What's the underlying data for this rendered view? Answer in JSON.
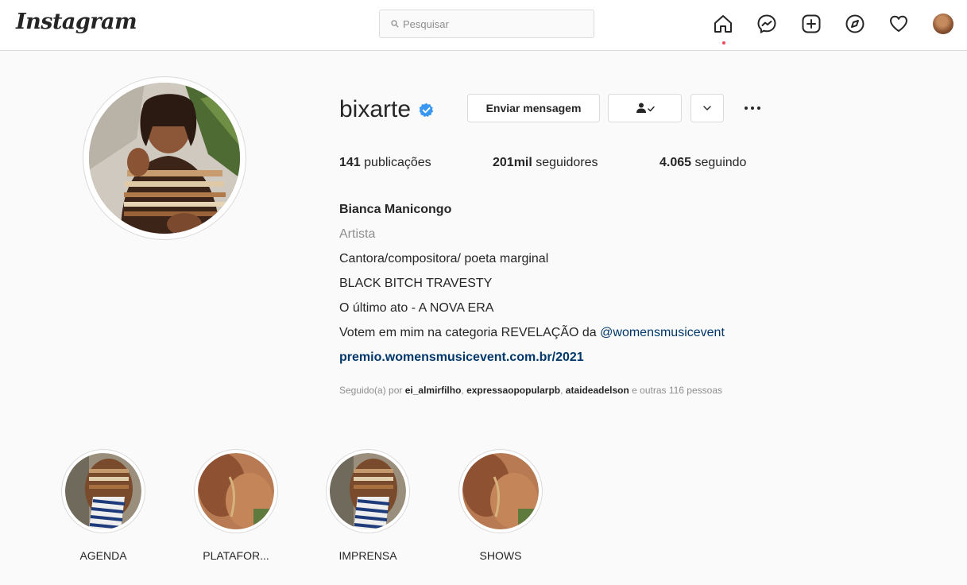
{
  "nav": {
    "logo": "Instagram",
    "search_placeholder": "Pesquisar",
    "icons": [
      "home-icon",
      "messenger-icon",
      "new-post-icon",
      "explore-icon",
      "activity-heart-icon",
      "profile-avatar"
    ]
  },
  "profile": {
    "username": "bixarte",
    "verified": true,
    "message_button": "Enviar mensagem",
    "stats": {
      "posts_count": "141",
      "posts_label": " publicações",
      "followers_count": "201mil",
      "followers_label": " seguidores",
      "following_count": "4.065",
      "following_label": " seguindo"
    },
    "bio": {
      "name": "Bianca Manicongo",
      "category": "Artista",
      "line1": "Cantora/compositora/ poeta marginal",
      "line2": "BLACK BITCH TRAVESTY",
      "line3": "O último ato - A NOVA ERA",
      "line4_prefix": "Votem em mim na categoria REVELAÇÃO da ",
      "line4_mention": "@womensmusicevent",
      "link": "premio.womensmusicevent.com.br/2021"
    },
    "followed_by": {
      "prefix": "Seguido(a) por ",
      "user1": "ei_almirfilho",
      "sep1": ", ",
      "user2": "expressaopopularpb",
      "sep2": ", ",
      "user3": "ataideadelson",
      "suffix": " e outras 116 pessoas"
    }
  },
  "highlights": [
    {
      "label": "AGENDA"
    },
    {
      "label": "PLATAFOR..."
    },
    {
      "label": "IMPRENSA"
    },
    {
      "label": "SHOWS"
    }
  ],
  "colors": {
    "verified_blue": "#3897f0",
    "link_blue": "#00376b",
    "secondary_text": "#8e8e8e",
    "border": "#dbdbdb",
    "notification_dot": "#ed4956"
  }
}
